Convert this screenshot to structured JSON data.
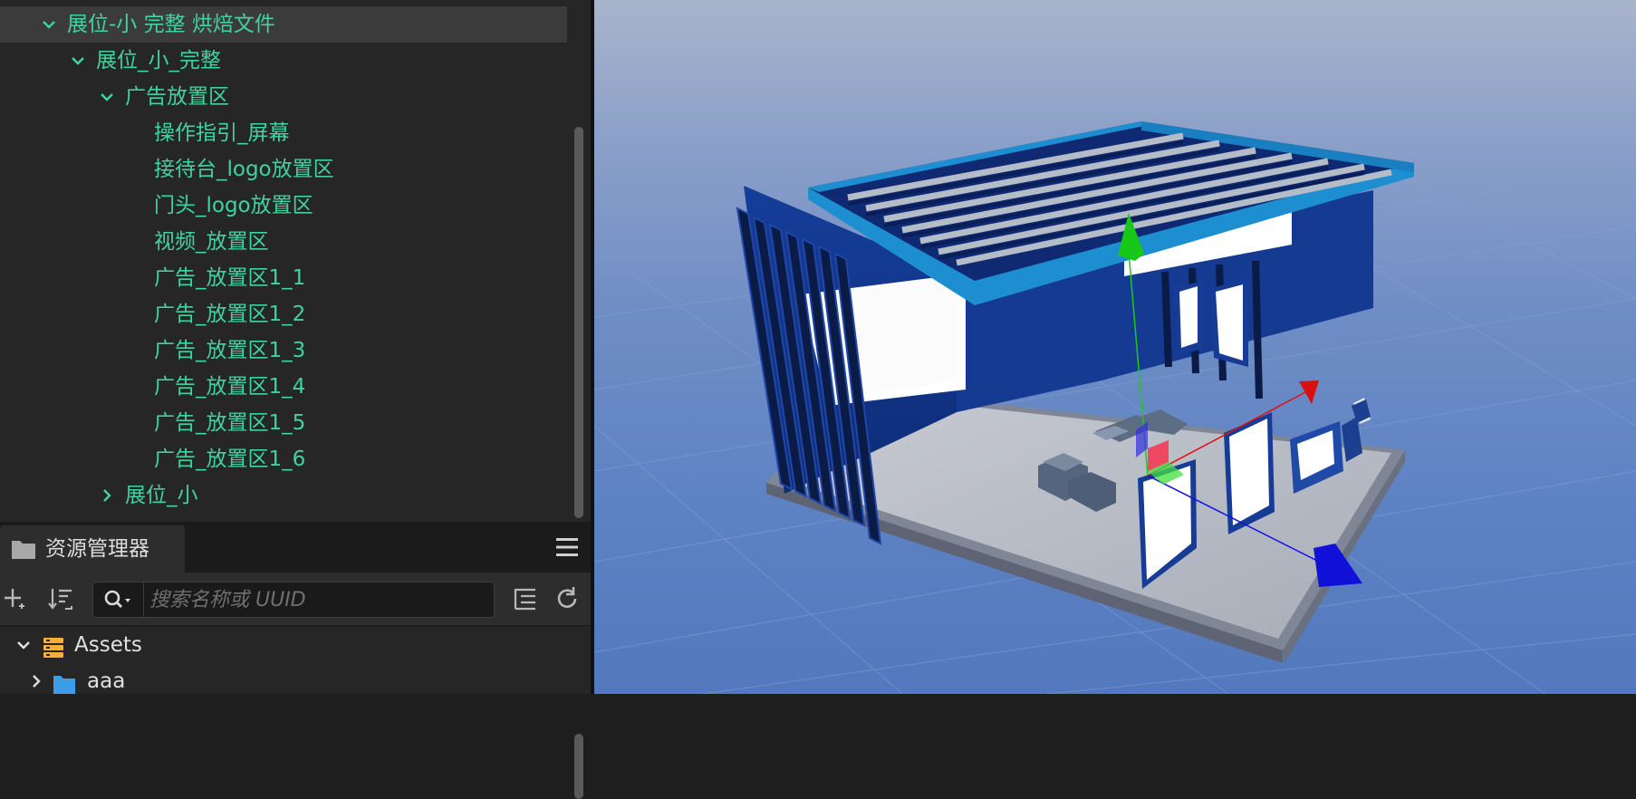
{
  "hierarchy": {
    "items": [
      {
        "label": "展位-小 完整 烘焙文件",
        "expanded": true,
        "selected": true
      },
      {
        "label": "展位_小_完整",
        "expanded": true
      },
      {
        "label": "广告放置区",
        "expanded": true
      },
      {
        "label": "操作指引_屏幕"
      },
      {
        "label": "接待台_logo放置区"
      },
      {
        "label": "门头_logo放置区"
      },
      {
        "label": "视频_放置区"
      },
      {
        "label": "广告_放置区1_1"
      },
      {
        "label": "广告_放置区1_2"
      },
      {
        "label": "广告_放置区1_3"
      },
      {
        "label": "广告_放置区1_4"
      },
      {
        "label": "广告_放置区1_5"
      },
      {
        "label": "广告_放置区1_6"
      },
      {
        "label": "展位_小",
        "expanded": false
      }
    ]
  },
  "assets_panel": {
    "tab_label": "资源管理器",
    "tab_icon": "folder-icon",
    "menu_icon": "hamburger-menu-icon",
    "toolbar": {
      "add_icon": "plus-icon",
      "sort_icon": "sort-icon",
      "search_icon": "search-icon",
      "collapse_icon": "tree-collapse-icon",
      "refresh_icon": "refresh-icon"
    },
    "search": {
      "placeholder": "搜索名称或 UUID",
      "value": ""
    },
    "tree": [
      {
        "label": "Assets",
        "expanded": true,
        "icon": "database-icon"
      },
      {
        "label": "aaa",
        "expanded": false,
        "icon": "folder-icon"
      }
    ]
  },
  "viewport": {
    "gizmo_colors": {
      "x": "#e01010",
      "y": "#1ec81e",
      "z": "#1010e0"
    },
    "background_top": "#a9b4cc",
    "background_bottom": "#5378bd"
  },
  "colors": {
    "tree_text": "#3fd3a0",
    "panel_bg": "#262626",
    "selected_row": "#3b3b3b"
  }
}
